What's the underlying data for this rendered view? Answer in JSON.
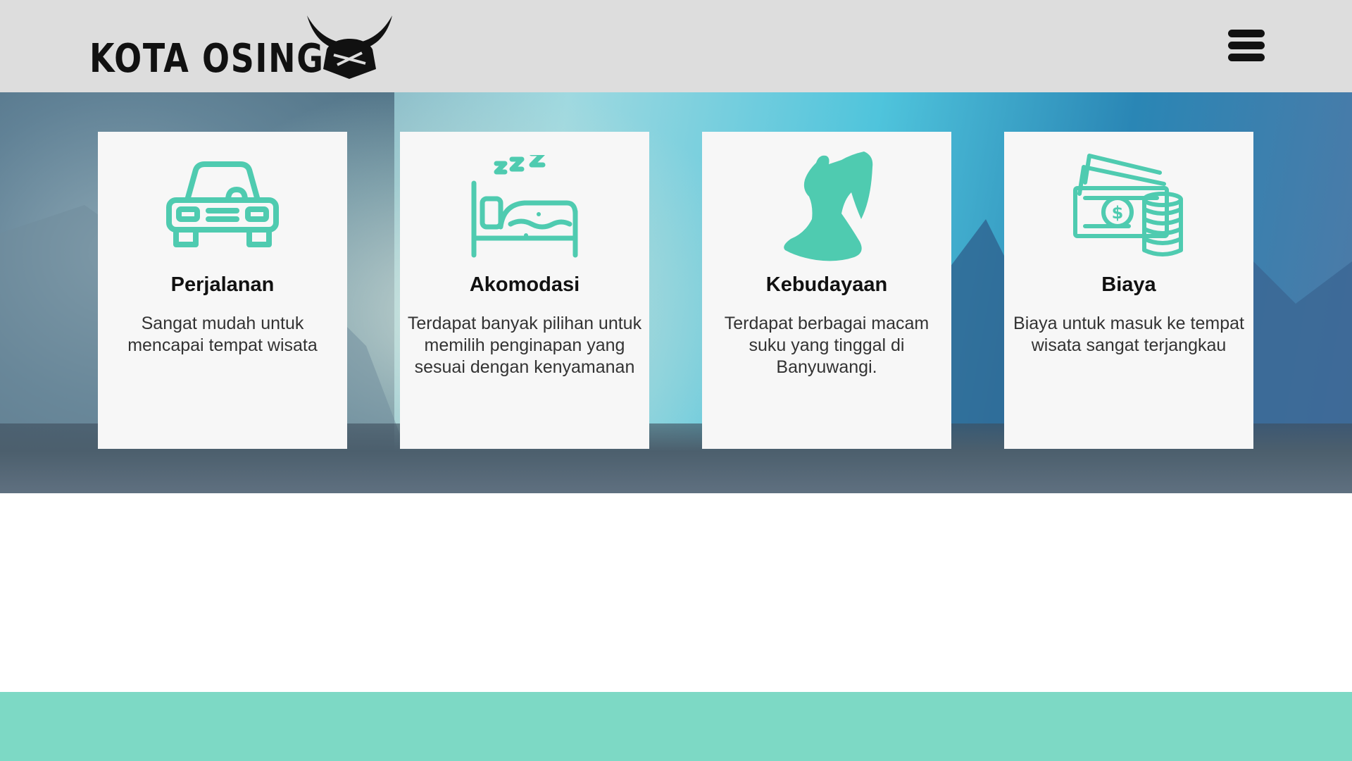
{
  "brand": {
    "name": "KOTA OSING",
    "accent_color": "#4fcbb0",
    "footer_color": "#7dd9c5"
  },
  "header": {
    "menu_icon": "hamburger-menu-icon"
  },
  "features": [
    {
      "icon": "car-icon",
      "title": "Perjalanan",
      "description": "Sangat mudah untuk mencapai tempat wisata"
    },
    {
      "icon": "sleeping-bed-icon",
      "title": "Akomodasi",
      "description": "Terdapat banyak pilihan untuk memilih penginapan yang sesuai dengan kenyamanan"
    },
    {
      "icon": "dancer-icon",
      "title": "Kebudayaan",
      "description": "Terdapat berbagai macam suku yang tinggal di Banyuwangi."
    },
    {
      "icon": "money-coins-icon",
      "title": "Biaya",
      "description": "Biaya untuk masuk ke tempat wisata sangat terjangkau"
    }
  ]
}
